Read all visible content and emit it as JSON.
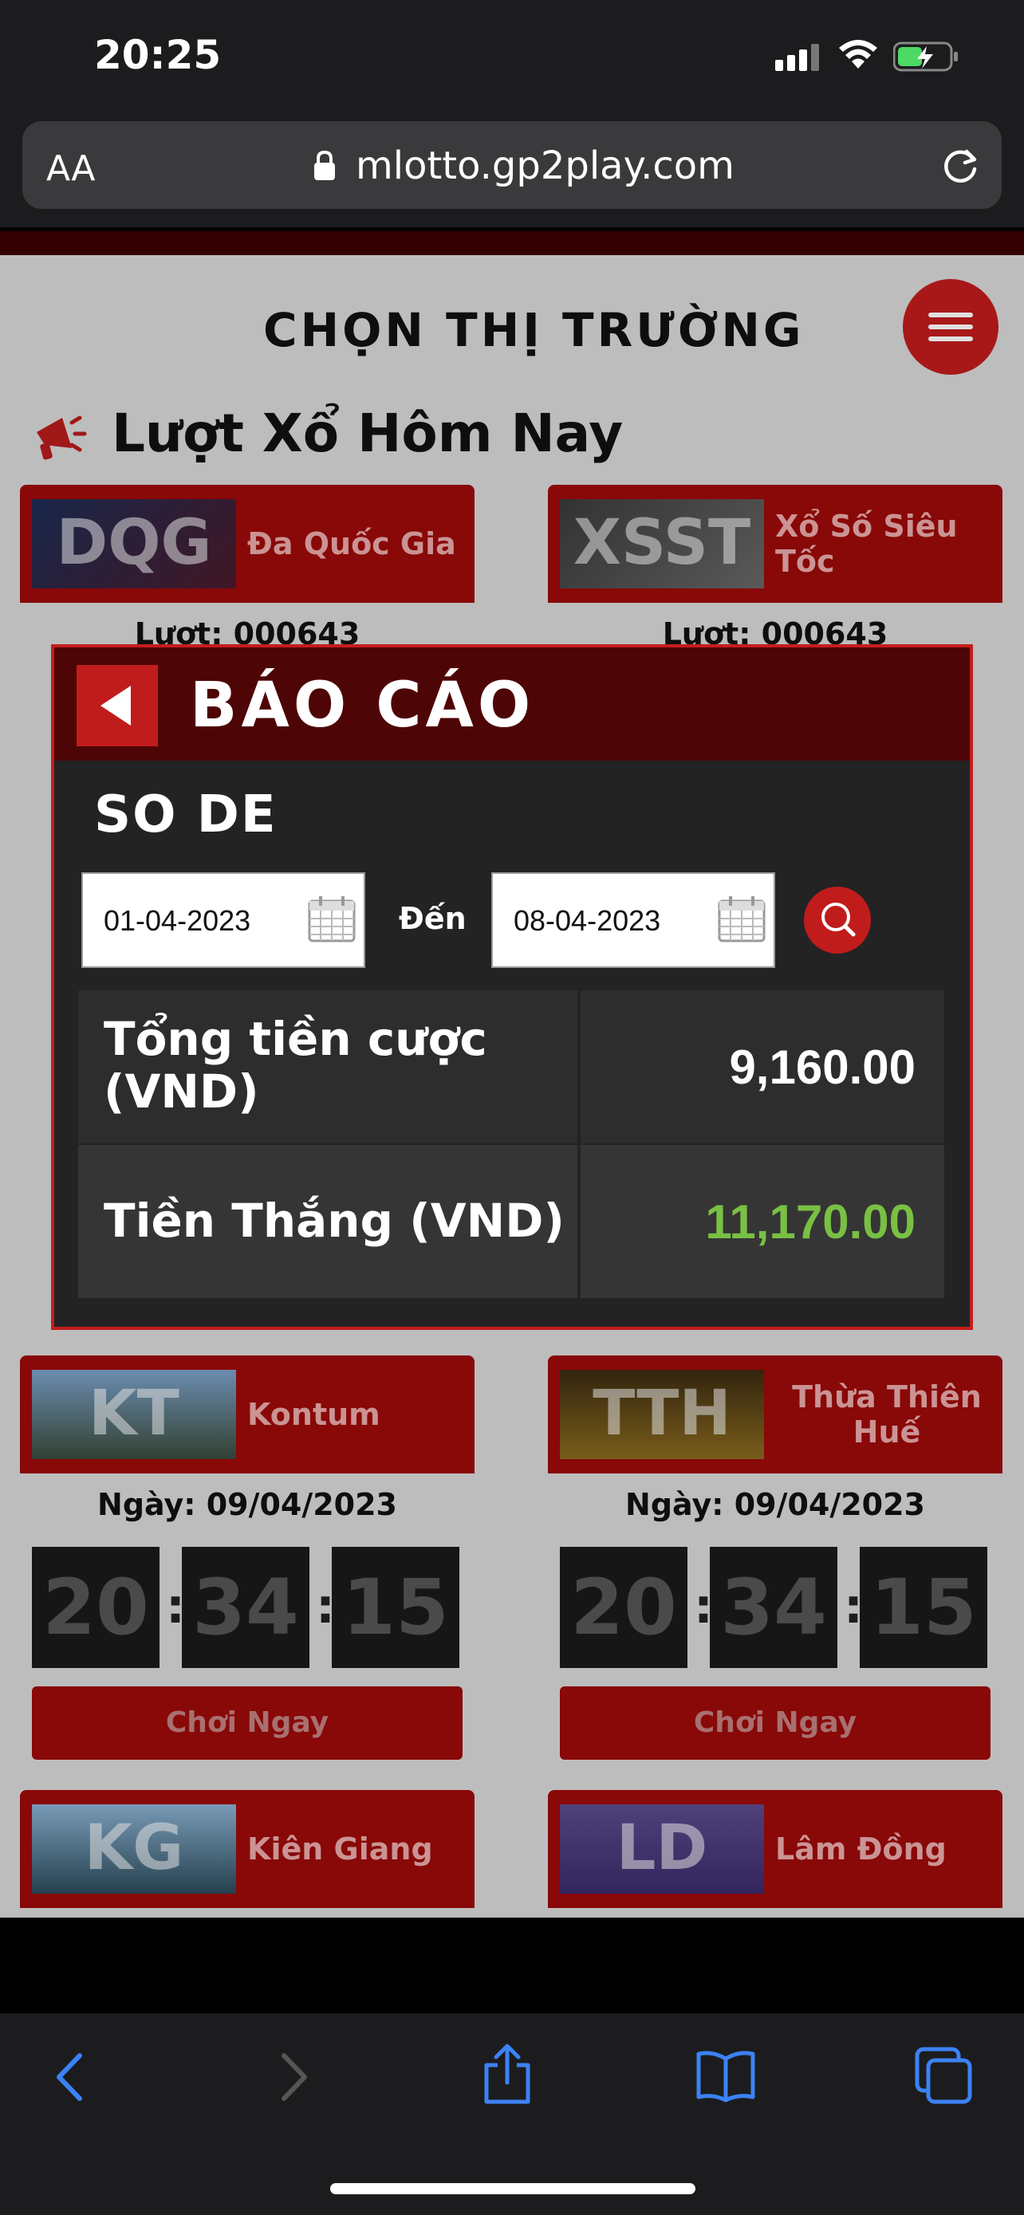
{
  "status_bar": {
    "time": "20:25"
  },
  "browser": {
    "aa_label": "AA",
    "url": "mlotto.gp2play.com"
  },
  "page": {
    "market_title": "CHỌN THỊ TRƯỜNG",
    "today_title": "Lượt Xổ Hôm Nay",
    "cards": [
      {
        "code": "DQG",
        "name": "Đa Quốc Gia",
        "sub": "Lượt: 000643"
      },
      {
        "code": "XSST",
        "name": "Xổ Số Siêu Tốc",
        "sub": "Lượt: 000643"
      },
      {
        "code": "KT",
        "name": "Kontum",
        "sub": "Ngày: 09/04/2023",
        "timer": [
          "20",
          "34",
          "15"
        ],
        "play": "Chơi Ngay"
      },
      {
        "code": "TTH",
        "name": "Thừa Thiên Huế",
        "sub": "Ngày: 09/04/2023",
        "timer": [
          "20",
          "34",
          "15"
        ],
        "play": "Chơi Ngay"
      },
      {
        "code": "KG",
        "name": "Kiên Giang"
      },
      {
        "code": "LD",
        "name": "Lâm Đồng"
      }
    ]
  },
  "modal": {
    "title": "BÁO CÁO",
    "subtitle": "SO DE",
    "from_date": "01-04-2023",
    "to_label": "Đến",
    "to_date": "08-04-2023",
    "rows": [
      {
        "label_line1": "Tổng tiền cược",
        "label_line2": "(VND)",
        "value": "9,160.00",
        "value_color": "#ffffff"
      },
      {
        "label": "Tiền Thắng (VND)",
        "value": "11,170.00",
        "value_color": "#79c043"
      }
    ]
  },
  "colors": {
    "accent": "#c11c1c",
    "modal_header": "#4e0505",
    "win_green": "#79c043"
  },
  "toolbar": {
    "icons": [
      "back-icon",
      "forward-icon",
      "share-icon",
      "bookmarks-icon",
      "tabs-icon"
    ]
  }
}
